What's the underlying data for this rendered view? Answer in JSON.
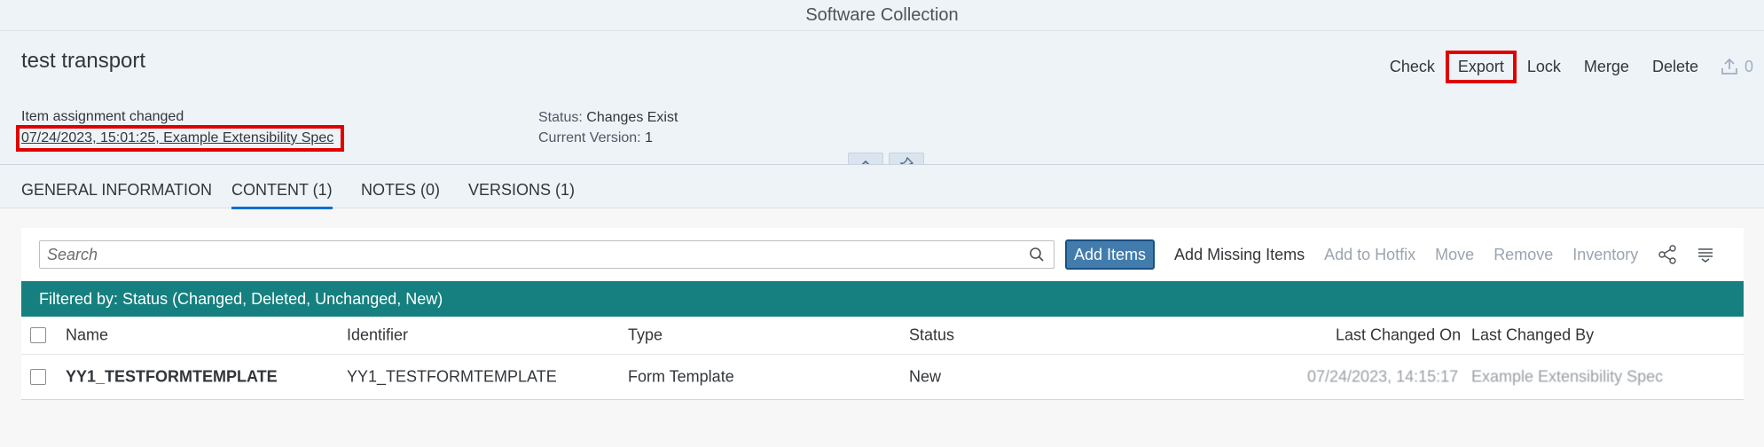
{
  "app_title": "Software Collection",
  "object": {
    "title": "test transport",
    "actions": [
      "Check",
      "Export",
      "Lock",
      "Merge",
      "Delete"
    ],
    "upload_count": "0",
    "attributes": {
      "left_label": "Item assignment changed",
      "left_value": "07/24/2023, 15:01:25, Example Extensibility Spec",
      "status_key": "Status:",
      "status_value": "Changes Exist",
      "version_key": "Current Version:",
      "version_value": "1"
    }
  },
  "tabs": [
    {
      "label": "GENERAL INFORMATION"
    },
    {
      "label": "CONTENT (1)"
    },
    {
      "label": "NOTES (0)"
    },
    {
      "label": "VERSIONS (1)"
    }
  ],
  "active_tab": "CONTENT (1)",
  "toolbar": {
    "search_placeholder": "Search",
    "add_items": "Add Items",
    "add_missing_items": "Add Missing Items",
    "add_to_hotfix": "Add to Hotfix",
    "move": "Move",
    "remove": "Remove",
    "inventory": "Inventory"
  },
  "filter_text": "Filtered by: Status (Changed, Deleted, Unchanged, New)",
  "table": {
    "columns": [
      "Name",
      "Identifier",
      "Type",
      "Status",
      "Last Changed On",
      "Last Changed By"
    ],
    "rows": [
      {
        "name": "YY1_TESTFORMTEMPLATE",
        "identifier": "YY1_TESTFORMTEMPLATE",
        "type": "Form Template",
        "status": "New",
        "last_changed_on": "07/24/2023, 14:15:17",
        "last_changed_by": "Example Extensibility Spec"
      }
    ]
  },
  "colors": {
    "filter_bar": "#15807f",
    "primary_button": "#427cac",
    "highlight": "#e00000",
    "header_bg": "#eef3f8"
  }
}
